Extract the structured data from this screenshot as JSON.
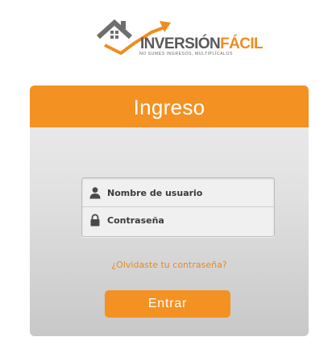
{
  "logo": {
    "brand_main": "INVERSIÓN",
    "brand_accent": "FÁCIL",
    "tagline": "NO SUMES INGRESOS, MULTIPLÍCALOS",
    "icon": "house-growth-arrow-icon"
  },
  "login": {
    "title": "Ingreso",
    "username": {
      "placeholder": "Nombre de usuario",
      "value": "",
      "icon": "user-icon"
    },
    "password": {
      "placeholder": "Contraseña",
      "value": "",
      "icon": "lock-icon"
    },
    "forgot_link": "¿Olvidaste tu contraseña?",
    "submit_label": "Entrar"
  },
  "colors": {
    "accent": "#f39223",
    "link": "#e8891d",
    "brand_gray": "#5a5a5a"
  }
}
